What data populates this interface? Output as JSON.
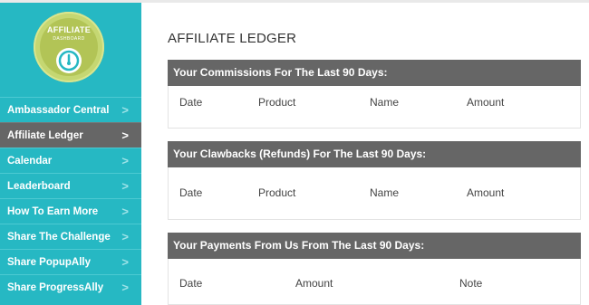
{
  "badge": {
    "title": "AFFILIATE",
    "subtitle": "DASHBOARD"
  },
  "sidebar": {
    "items": [
      {
        "label": "Ambassador Central",
        "chevron": ">"
      },
      {
        "label": "Affiliate Ledger",
        "chevron": ">",
        "active": true
      },
      {
        "label": "Calendar",
        "chevron": ">"
      },
      {
        "label": "Leaderboard",
        "chevron": ">"
      },
      {
        "label": "How To Earn More",
        "chevron": ">"
      },
      {
        "label": "Share The Challenge",
        "chevron": ">"
      },
      {
        "label": "Share PopupAlly",
        "chevron": ">"
      },
      {
        "label": "Share ProgressAlly",
        "chevron": ">"
      }
    ]
  },
  "main": {
    "title": "AFFILIATE LEDGER",
    "commissions": {
      "header": "Your Commissions For The Last 90 Days:",
      "columns": [
        "Date",
        "Product",
        "Name",
        "Amount"
      ]
    },
    "clawbacks": {
      "header": "Your Clawbacks (Refunds) For The Last 90 Days:",
      "columns": [
        "Date",
        "Product",
        "Name",
        "Amount"
      ]
    },
    "payments": {
      "header": "Your Payments From Us From The Last 90 Days:",
      "columns": [
        "Date",
        "Amount",
        "Note"
      ]
    }
  },
  "colors": {
    "sidebar": "#26b8c3",
    "active_item": "#666666",
    "panel_header": "#666666",
    "badge": "#c5d772"
  }
}
